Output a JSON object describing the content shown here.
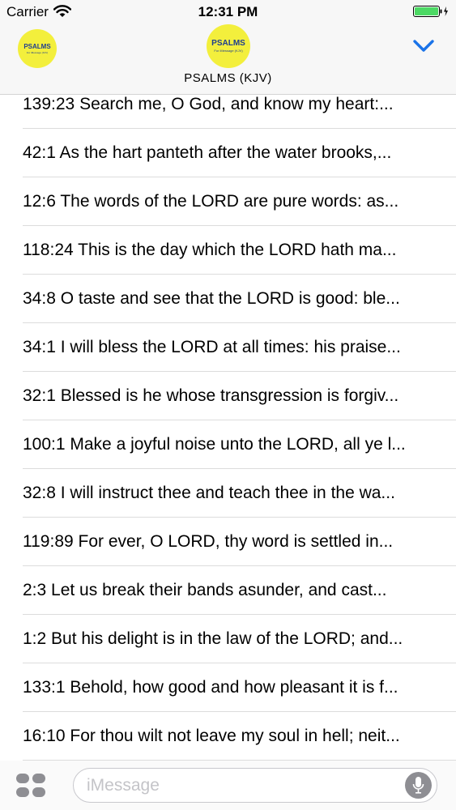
{
  "status_bar": {
    "carrier": "Carrier",
    "time": "12:31 PM"
  },
  "header": {
    "title": "PSALMS (KJV)",
    "badge_left": {
      "brand": "PSALMS",
      "subtitle": "For iMessage (KJV)"
    },
    "badge_center": {
      "brand": "PSALMS",
      "subtitle": "For iMessage (KJV)"
    }
  },
  "verses": [
    "139:23 Search me, O God, and know my heart:...",
    "42:1 As the hart panteth after the water brooks,...",
    "12:6 The words of the LORD are pure words: as...",
    "118:24 This is the day which the LORD hath ma...",
    "34:8 O taste and see that the LORD is good: ble...",
    "34:1 I will bless the LORD at all times: his praise...",
    "32:1 Blessed is he whose transgression is forgiv...",
    "100:1 Make a joyful noise unto the LORD, all ye l...",
    "32:8 I will instruct thee and teach thee in the wa...",
    "119:89 For ever, O LORD, thy word is settled in...",
    "2:3 Let us break their bands asunder, and cast...",
    "1:2 But his delight is in the law of the LORD; and...",
    "133:1 Behold, how good and how pleasant it is f...",
    "16:10 For thou wilt not leave my soul in hell; neit..."
  ],
  "input_bar": {
    "placeholder": "iMessage"
  },
  "icons": {
    "wifi": "wifi-icon",
    "battery": "battery-icon",
    "collapse": "chevron-down-icon",
    "apps": "apps-icon",
    "mic": "mic-icon"
  },
  "colors": {
    "accent": "#1a73e8",
    "badge": "#f3ef3c",
    "battery": "#4cd964"
  }
}
